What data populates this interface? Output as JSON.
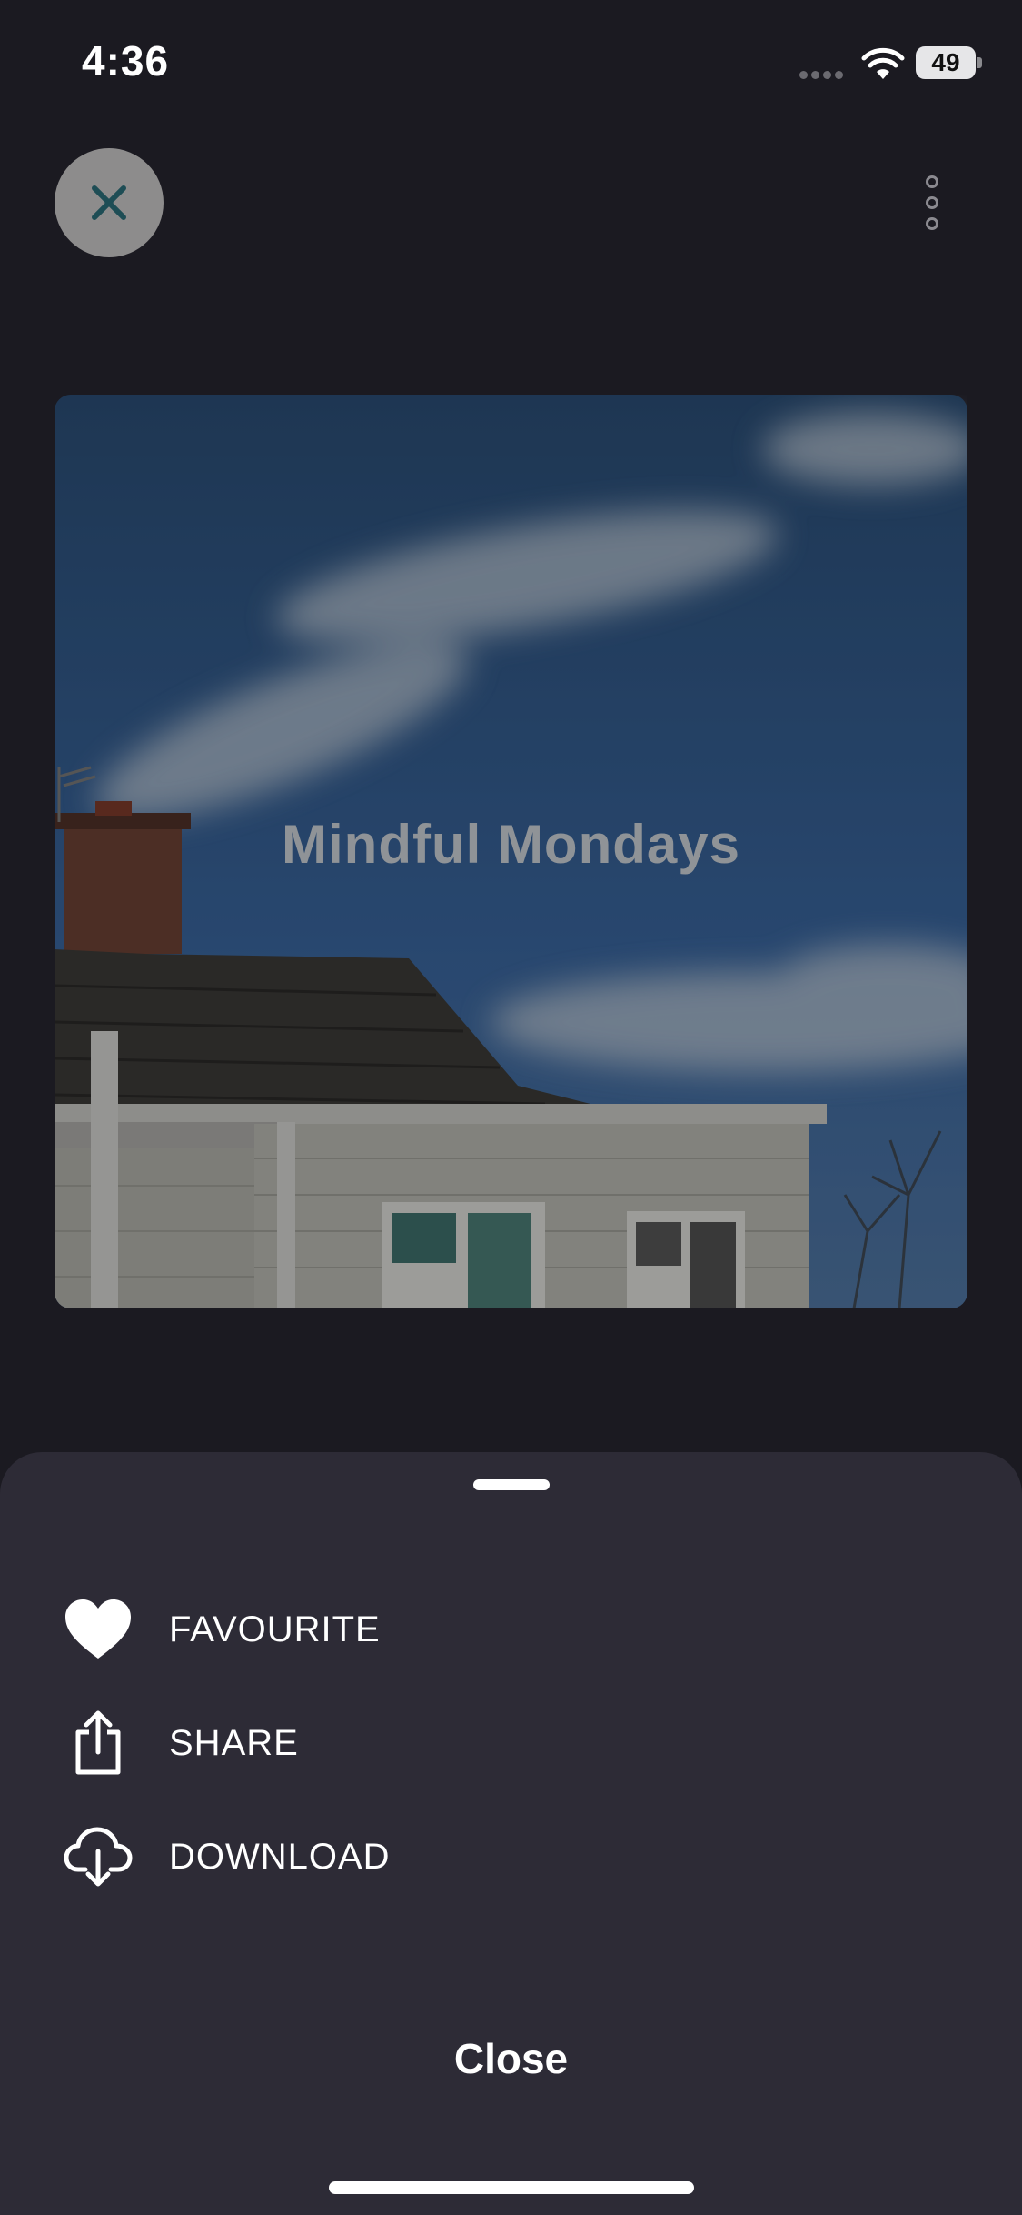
{
  "status_bar": {
    "time": "4:36",
    "battery": "49"
  },
  "top_bar": {
    "close_icon": "close-icon",
    "more_icon": "more-vertical-icon"
  },
  "artwork": {
    "title": "Mindful Mondays"
  },
  "sheet": {
    "items": [
      {
        "label": "FAVOURITE",
        "icon": "heart-icon"
      },
      {
        "label": "SHARE",
        "icon": "share-icon"
      },
      {
        "label": "DOWNLOAD",
        "icon": "cloud-download-icon"
      }
    ],
    "close_label": "Close"
  },
  "colors": {
    "background": "#1b1a21",
    "sheet": "#2d2b36",
    "close_circle": "#8d8c8c",
    "close_x": "#1e4d55"
  }
}
